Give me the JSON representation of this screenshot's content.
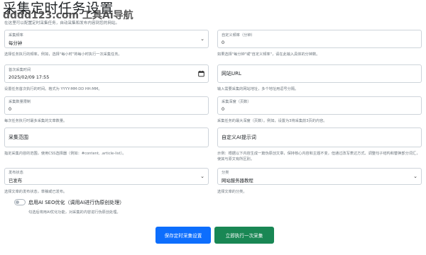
{
  "header": {
    "title": "采集定时任务设置",
    "watermark": "dddd123.com 工具Ai导航",
    "subtitle": "在这里可以配置定时采集任务，自动采集和发布内容到您的网站。"
  },
  "fields": {
    "frequency": {
      "label": "采集频率",
      "value": "每分钟",
      "help": "选择任务执行的频率。例如，选择\"每小时\"将每小时执行一次采集任务。"
    },
    "custom_frequency": {
      "label": "自定义频率（分钟）",
      "value": "0",
      "help": "如果选择\"每分钟\"或\"自定义频率\"，请在此输入具体的分钟数。"
    },
    "next_run": {
      "label": "首次采集时间",
      "value": "2025/02/09 17:55",
      "help": "设置任务首次执行的时间。格式为 YYYY-MM-DD HH:MM。"
    },
    "url": {
      "placeholder": "网站URL",
      "help": "输入需要采集的网站地址，多个地址用逗号分隔。"
    },
    "limit": {
      "label": "采集数量限制",
      "value": "0",
      "help": "每次任务执行时最多采集的文章数量。"
    },
    "depth": {
      "label": "采集深度（页数）",
      "value": "0",
      "help": "采集任务的最大深度（页数）。例如，设置为3将采集前3页的内容。"
    },
    "scope": {
      "placeholder": "采集范围",
      "help": "指定采集内容的范围，使用CSS选择器（例如：#content, .article-list）。"
    },
    "ai_prompt": {
      "placeholder": "自定义AI提示词",
      "help": "示例：根据以下内容生成一篇伪原创文章，保持核心内容和主题不变，但通过改写表达方式、调整句子结构和替换部分词汇，使其与原文有所区别。"
    },
    "publish_status": {
      "label": "发布状态",
      "value": "已发布",
      "help": "选择文章的发布状态，草稿或已发布。"
    },
    "category": {
      "label": "分类",
      "value": "网站服务器教程",
      "help": "选择文章的分类。"
    }
  },
  "seo_toggle": {
    "label": "启用AI SEO优化（调用AI进行伪原创处理）",
    "checked": false,
    "help": "勾选后将用AI优化功能，对采集的内容进行伪原创处理。"
  },
  "buttons": {
    "save": "保存定时采集设置",
    "run_once": "立即执行一次采集"
  },
  "colors": {
    "primary": "#0d6efd",
    "success": "#198754",
    "border": "#ced4da",
    "muted": "#6c757d"
  },
  "icons": {
    "select": "chevron-down-icon",
    "datetime": "calendar-icon"
  }
}
